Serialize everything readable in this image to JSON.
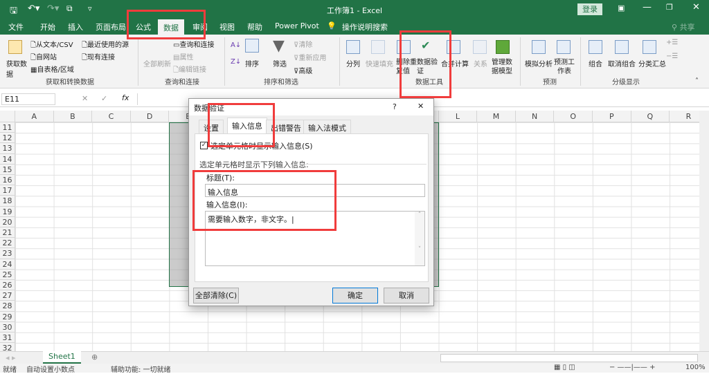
{
  "titlebar": {
    "title": "工作簿1  -  Excel",
    "login": "登录",
    "qat_more": "▿"
  },
  "tabs": [
    "文件",
    "开始",
    "插入",
    "页面布局",
    "公式",
    "数据",
    "审阅",
    "视图",
    "帮助",
    "Power Pivot"
  ],
  "active_tab": "数据",
  "tell_me": "操作说明搜索",
  "share": "共享",
  "ribbon": {
    "get_data": "获取数据",
    "from_csv": "从文本/CSV",
    "from_web": "自网站",
    "from_table": "自表格/区域",
    "recent": "最近使用的源",
    "existing": "现有连接",
    "group1": "获取和转换数据",
    "refresh_all": "全部刷新",
    "queries": "查询和连接",
    "properties": "属性",
    "edit_links": "编辑链接",
    "group2": "查询和连接",
    "sort": "排序",
    "filter": "筛选",
    "clear": "清除",
    "reapply": "重新应用",
    "advanced": "高级",
    "group3": "排序和筛选",
    "text_to_cols": "分列",
    "flash_fill": "快速填充",
    "remove_dup": "删除重复值",
    "validation": "数据验证",
    "consolidate": "合并计算",
    "relations": "关系",
    "data_model": "管理数据模型",
    "group4": "数据工具",
    "whatif": "模拟分析",
    "forecast": "预测工作表",
    "group5": "预测",
    "group_btn": "组合",
    "ungroup": "取消组合",
    "subtotal": "分类汇总",
    "group6": "分级显示"
  },
  "formula_bar": {
    "name_box": "E11",
    "fx": "fx",
    "cancel": "✕",
    "enter": "✓",
    "value": ""
  },
  "columns": [
    "A",
    "B",
    "C",
    "D",
    "E",
    "F",
    "G",
    "H",
    "I",
    "J",
    "K",
    "L",
    "M",
    "N",
    "O",
    "P",
    "Q",
    "R"
  ],
  "rows": [
    "11",
    "12",
    "13",
    "14",
    "15",
    "16",
    "17",
    "18",
    "19",
    "20",
    "21",
    "22",
    "23",
    "24",
    "25",
    "26",
    "27",
    "28",
    "29",
    "30",
    "31",
    "32"
  ],
  "sheet_tabs": [
    "Sheet1"
  ],
  "status": {
    "ready": "就绪",
    "auto_decimal": "自动设置小数点",
    "accessibility": "辅助功能: 一切就绪",
    "zoom": "100%"
  },
  "dialog": {
    "title": "数据验证",
    "help": "?",
    "close": "✕",
    "tabs": [
      "设置",
      "输入信息",
      "出错警告",
      "输入法模式"
    ],
    "active_tab": "输入信息",
    "show_checkbox": "选定单元格时显示输入信息(S)",
    "show_checked": true,
    "section": "选定单元格时显示下列输入信息:",
    "title_label": "标题(T):",
    "title_value": "输入信息",
    "msg_label": "输入信息(I):",
    "msg_value": "需要输入数字，非文字。",
    "clear_all": "全部清除(C)",
    "ok": "确定",
    "cancel": "取消"
  },
  "colors": {
    "excel_green": "#217346",
    "annotation_red": "#f03c3c"
  }
}
